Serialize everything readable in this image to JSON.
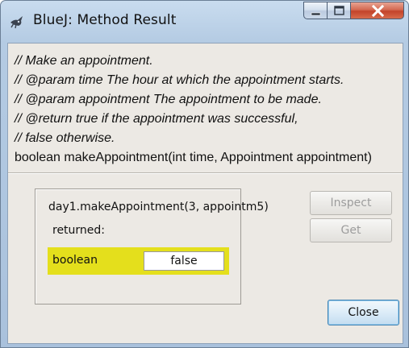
{
  "window": {
    "title": "BlueJ:  Method Result",
    "icon": "bluej-bird-icon"
  },
  "caption_buttons": {
    "minimize": "minimize-icon",
    "maximize": "maximize-icon",
    "close": "close-icon"
  },
  "comment": {
    "lines": [
      "// Make an appointment.",
      "// @param time The hour at which the appointment starts.",
      "// @param appointment The appointment to be made.",
      "// @return true if the appointment was successful,",
      "// false otherwise."
    ],
    "signature": "boolean makeAppointment(int time, Appointment appointment)"
  },
  "result": {
    "call": "day1.makeAppointment(3, appointm5)",
    "returned_label": "returned:",
    "type": "boolean",
    "value": "false",
    "highlight_color": "#e4df1c"
  },
  "buttons": {
    "inspect": "Inspect",
    "get": "Get",
    "close": "Close"
  }
}
